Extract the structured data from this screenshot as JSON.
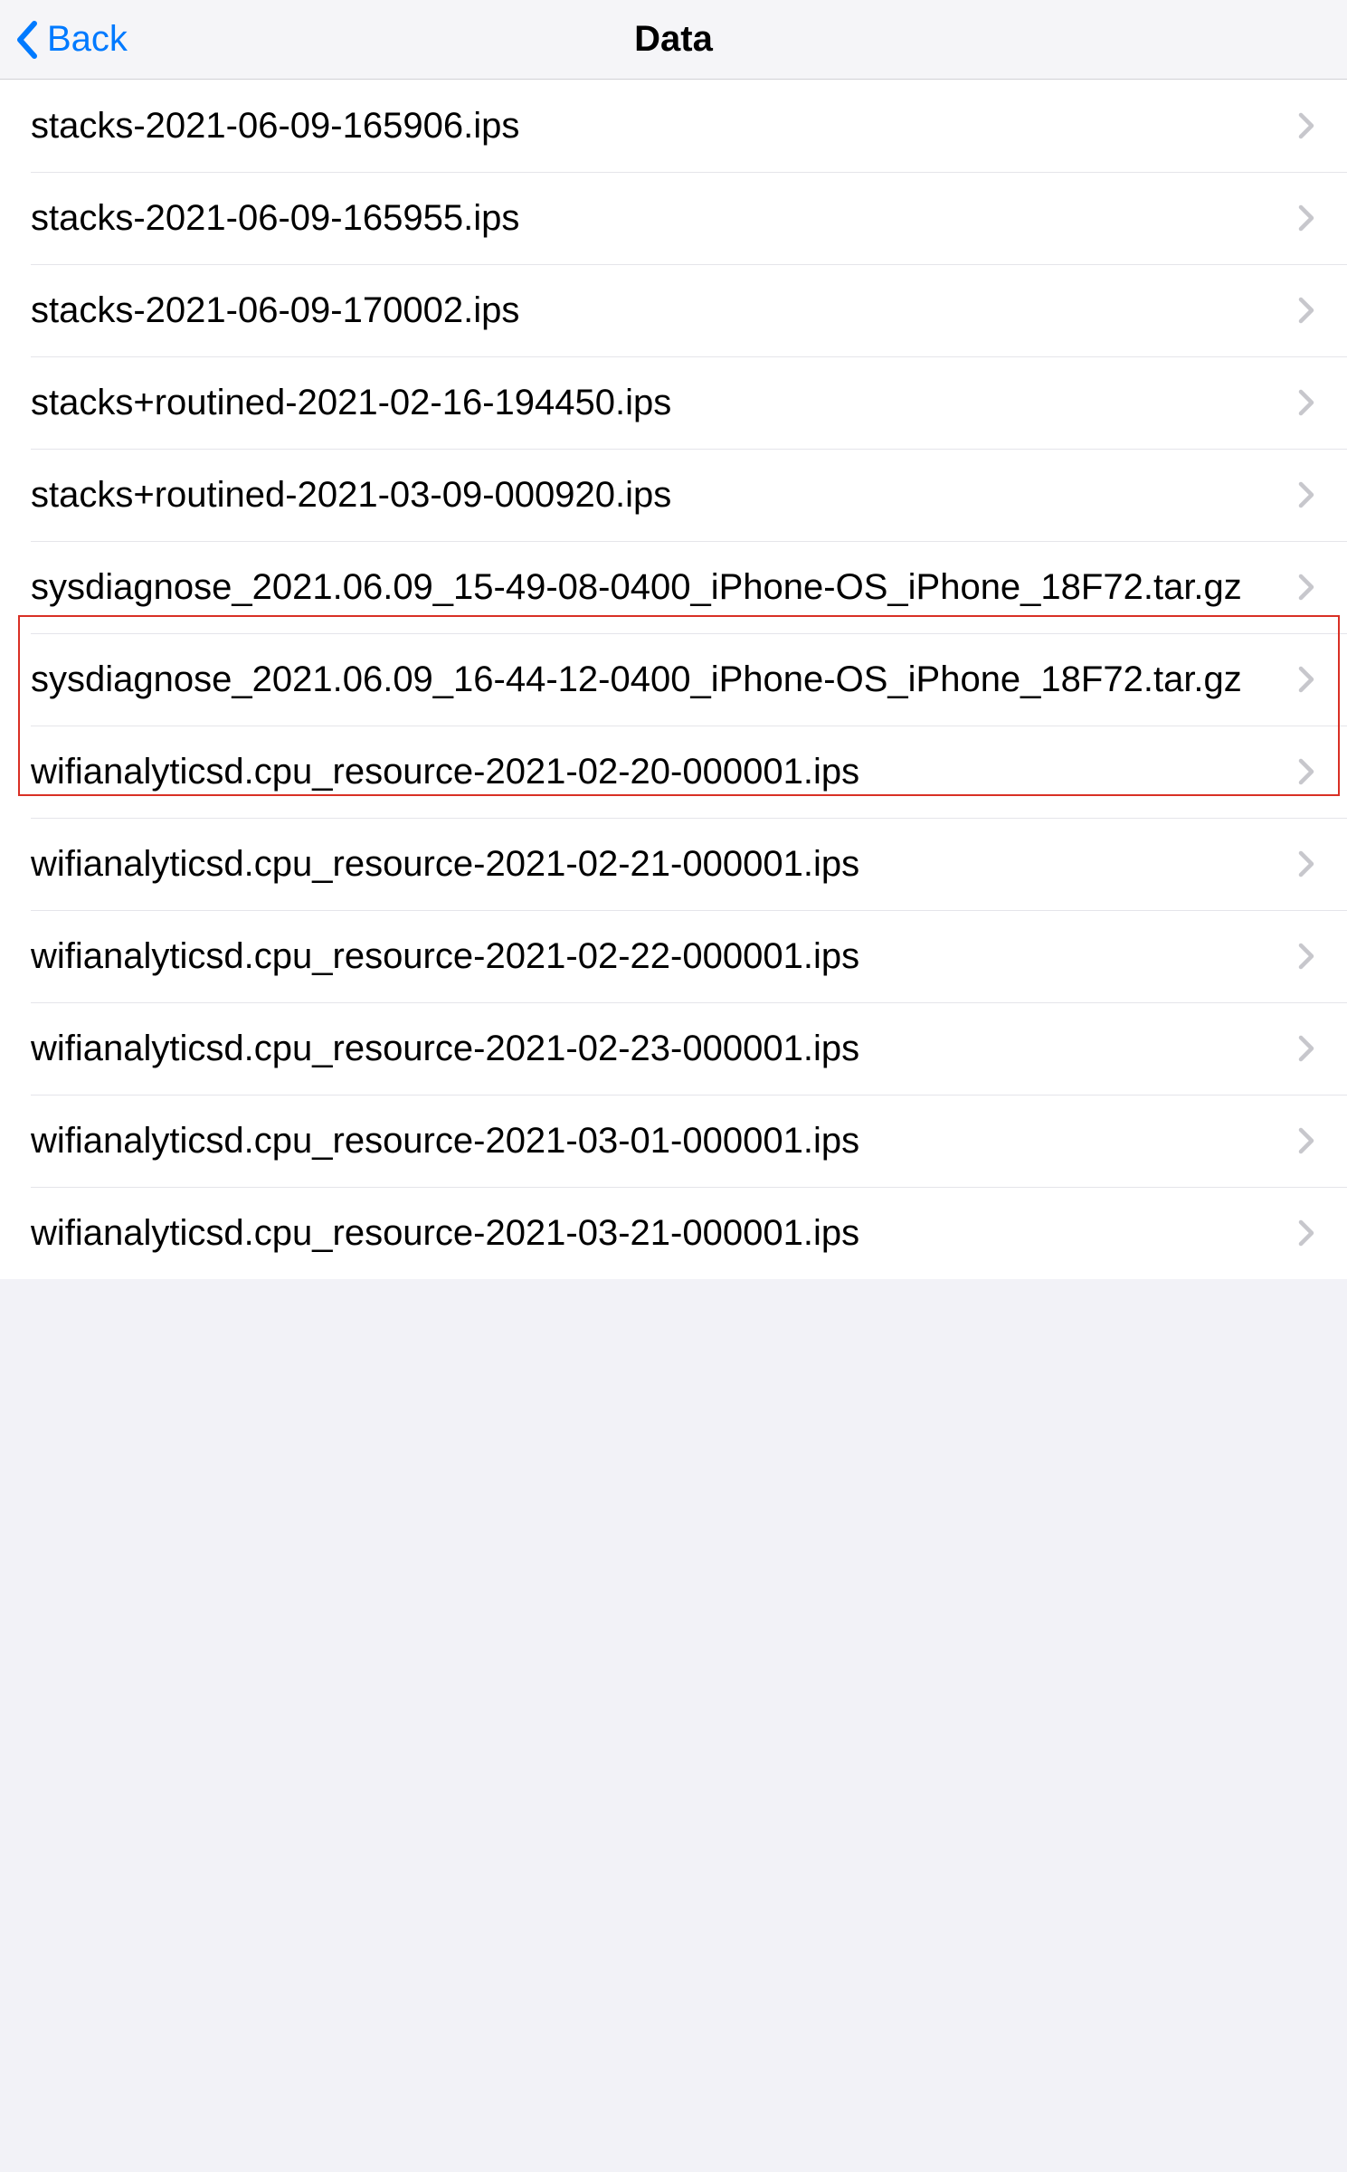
{
  "header": {
    "back_label": "Back",
    "title": "Data"
  },
  "list": {
    "items": [
      {
        "label": "stacks-2021-06-09-165906.ips",
        "highlighted": false
      },
      {
        "label": "stacks-2021-06-09-165955.ips",
        "highlighted": false
      },
      {
        "label": "stacks-2021-06-09-170002.ips",
        "highlighted": false
      },
      {
        "label": "stacks+routined-2021-02-16-194450.ips",
        "highlighted": false
      },
      {
        "label": "stacks+routined-2021-03-09-000920.ips",
        "highlighted": false
      },
      {
        "label": "sysdiagnose_2021.06.09_15-49-08-0400_iPhone-OS_iPhone_18F72.tar.gz",
        "highlighted": true
      },
      {
        "label": "sysdiagnose_2021.06.09_16-44-12-0400_iPhone-OS_iPhone_18F72.tar.gz",
        "highlighted": true
      },
      {
        "label": "wifianalyticsd.cpu_resource-2021-02-20-000001.ips",
        "highlighted": false
      },
      {
        "label": "wifianalyticsd.cpu_resource-2021-02-21-000001.ips",
        "highlighted": false
      },
      {
        "label": "wifianalyticsd.cpu_resource-2021-02-22-000001.ips",
        "highlighted": false
      },
      {
        "label": "wifianalyticsd.cpu_resource-2021-02-23-000001.ips",
        "highlighted": false
      },
      {
        "label": "wifianalyticsd.cpu_resource-2021-03-01-000001.ips",
        "highlighted": false
      },
      {
        "label": "wifianalyticsd.cpu_resource-2021-03-21-000001.ips",
        "highlighted": false
      }
    ]
  },
  "annotation": {
    "highlight_color": "#D93025"
  }
}
